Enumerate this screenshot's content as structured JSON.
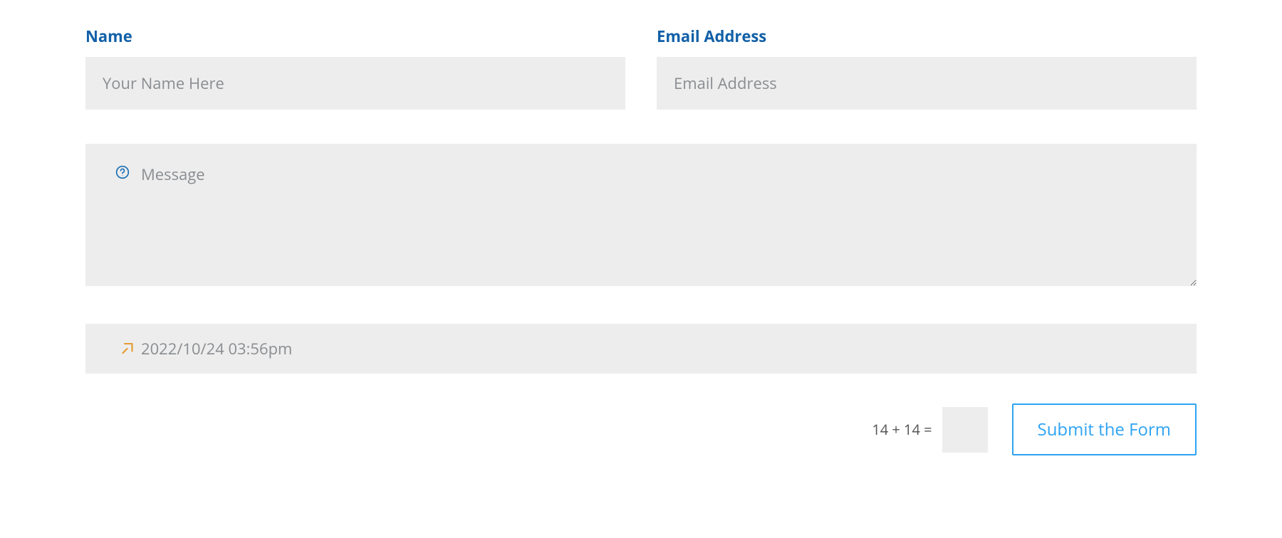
{
  "form": {
    "name": {
      "label": "Name",
      "placeholder": "Your Name Here",
      "value": ""
    },
    "email": {
      "label": "Email Address",
      "placeholder": "Email Address",
      "value": ""
    },
    "message": {
      "placeholder": "Message",
      "value": ""
    },
    "datetime": {
      "value": "2022/10/24 03:56pm"
    },
    "captcha": {
      "question": "14 + 14 =",
      "value": ""
    },
    "submit": {
      "label": "Submit the Form"
    }
  },
  "colors": {
    "label": "#1260a8",
    "accent": "#2ea3f2",
    "icon_help": "#1b6fb3",
    "icon_arrow": "#e39b2e",
    "field_bg": "#ededed",
    "placeholder": "#8a8d91"
  }
}
